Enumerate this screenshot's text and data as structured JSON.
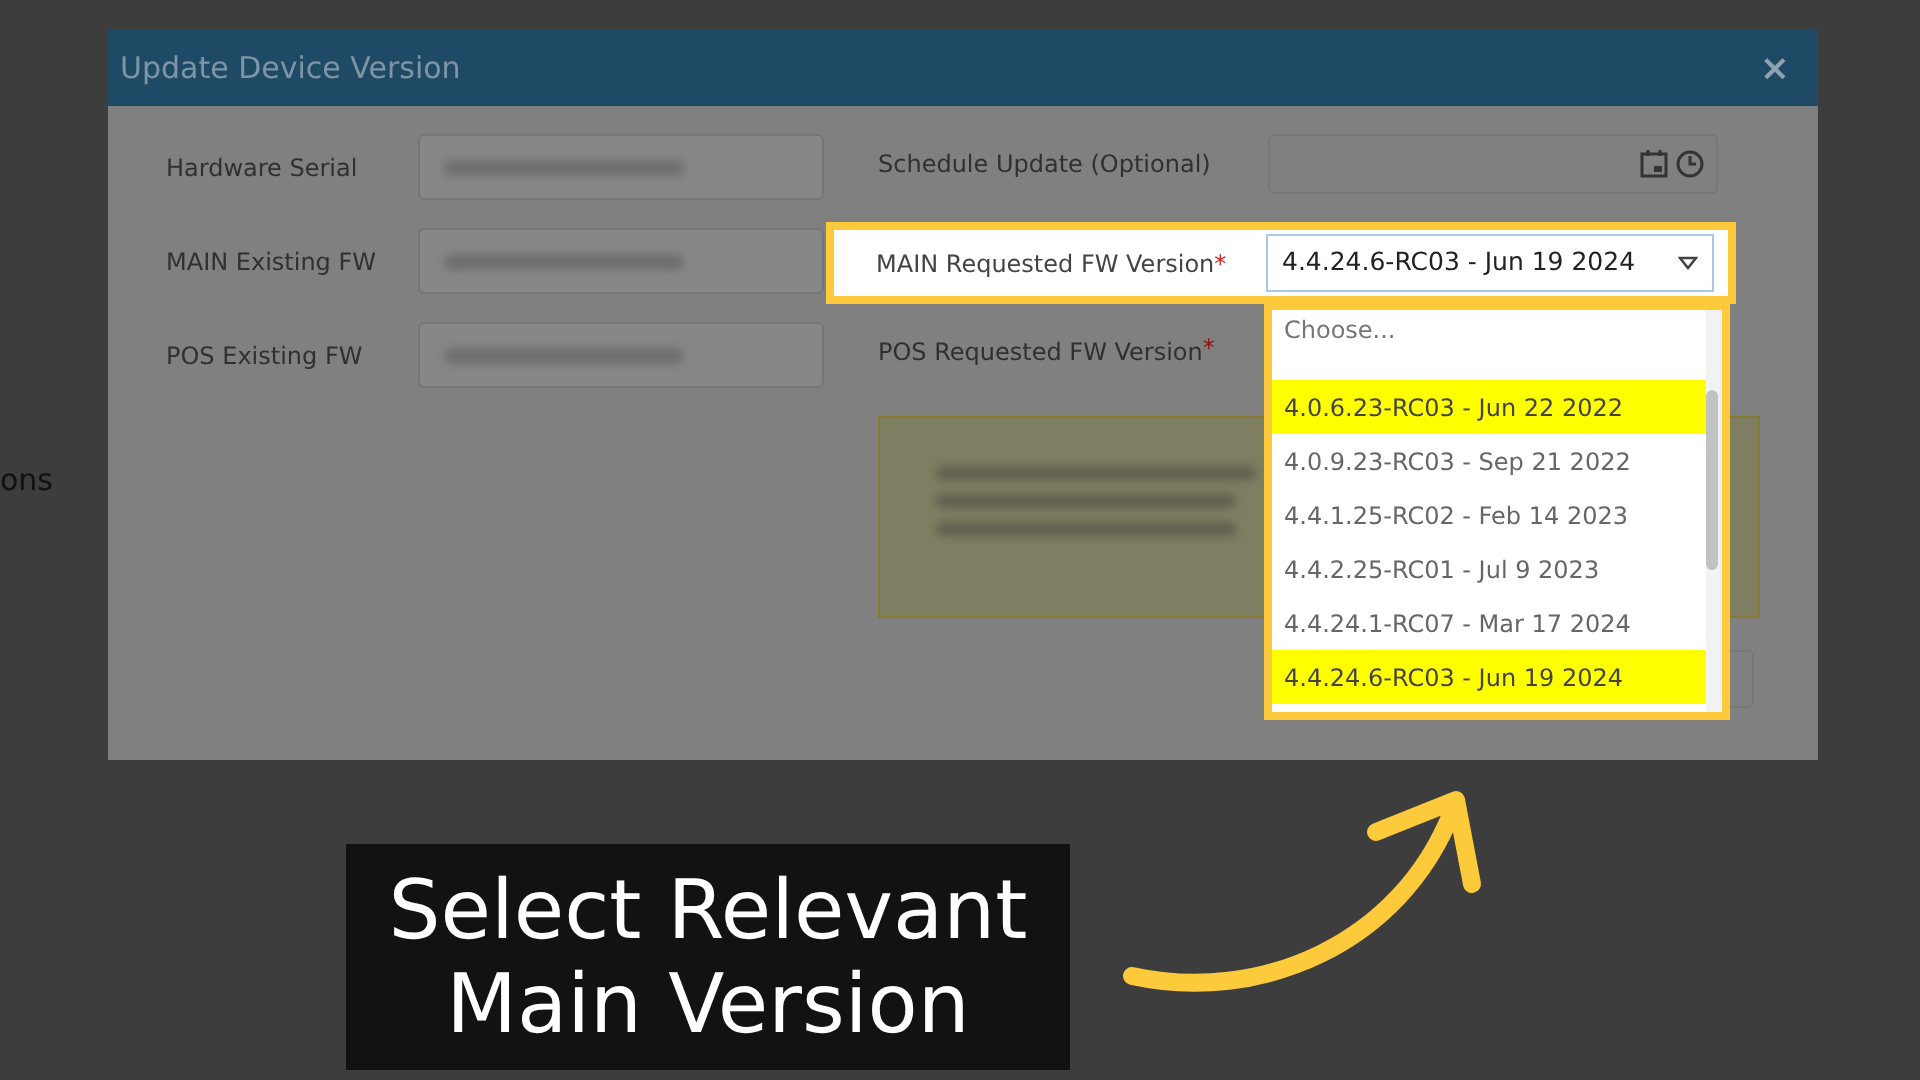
{
  "background_text": "ons",
  "dialog": {
    "title": "Update Device Version",
    "close": "×",
    "left_fields": [
      {
        "label": "Hardware Serial"
      },
      {
        "label": "MAIN Existing FW"
      },
      {
        "label": "POS Existing FW"
      }
    ],
    "schedule": {
      "label": "Schedule Update (Optional)"
    },
    "main_requested": {
      "label": "MAIN Requested FW Version",
      "required_mark": "*",
      "value": "4.4.24.6-RC03 - Jun 19 2024"
    },
    "pos_requested": {
      "label": "POS Requested FW Version",
      "required_mark": "*"
    }
  },
  "dropdown": {
    "placeholder": "Choose...",
    "options": [
      {
        "label": "4.0.6.23-RC03 - Jun 22 2022",
        "highlighted": true
      },
      {
        "label": "4.0.9.23-RC03 - Sep 21 2022",
        "highlighted": false
      },
      {
        "label": "4.4.1.25-RC02 - Feb 14 2023",
        "highlighted": false
      },
      {
        "label": "4.4.2.25-RC01 - Jul 9 2023",
        "highlighted": false
      },
      {
        "label": "4.4.24.1-RC07 - Mar 17 2024",
        "highlighted": false
      },
      {
        "label": "4.4.24.6-RC03 - Jun 19 2024",
        "highlighted": true
      }
    ]
  },
  "caption": {
    "lines": [
      "Select Relevant",
      "Main Version"
    ]
  }
}
